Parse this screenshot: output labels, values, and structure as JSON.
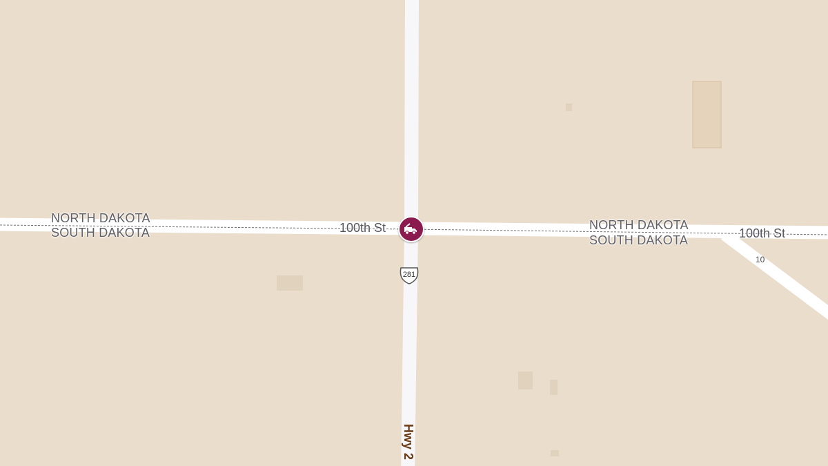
{
  "map": {
    "background_color": "#eaddcc",
    "road_color": "#ffffff",
    "state_labels": {
      "left_north": "NORTH DAKOTA",
      "left_south": "SOUTH DAKOTA",
      "right_north": "NORTH DAKOTA",
      "right_south": "SOUTH DAKOTA"
    },
    "roads": {
      "street_left": "100th St",
      "street_right": "100th St",
      "highway_vertical": "Hwy 2",
      "us_shield": "281",
      "route_10": "10"
    },
    "poi": {
      "icon": "tow-truck-icon",
      "color": "#8b1a4f"
    }
  }
}
